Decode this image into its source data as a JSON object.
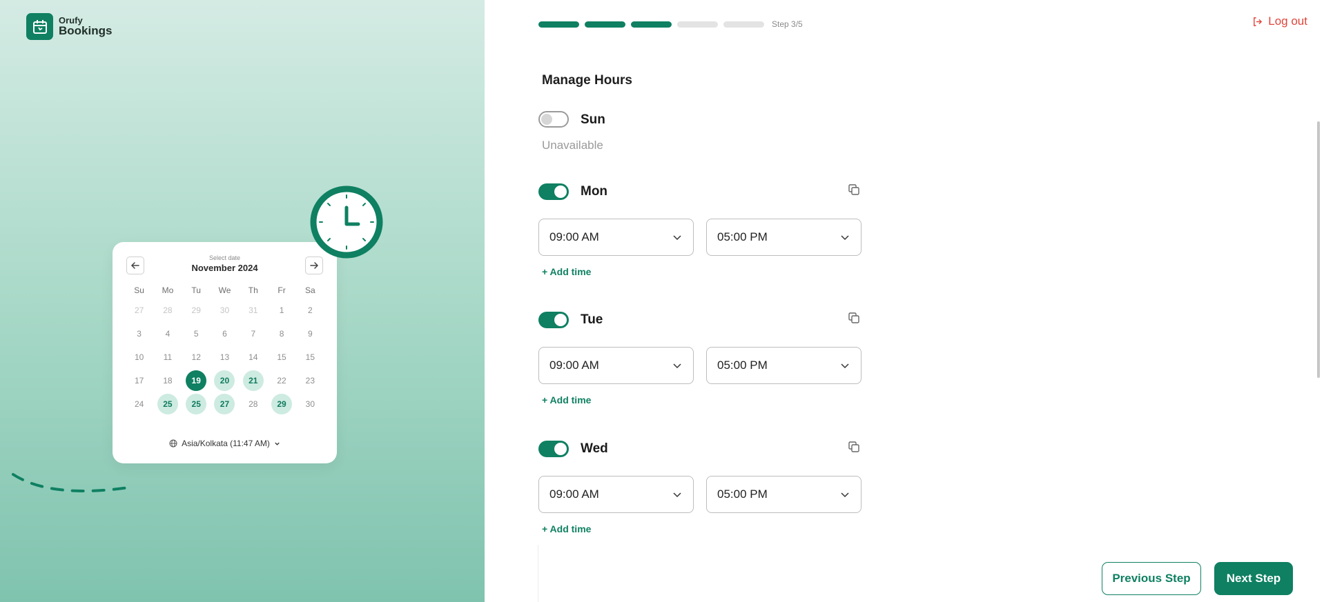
{
  "brand": {
    "name_small": "Orufy",
    "name_big": "Bookings",
    "color": "#0f8062",
    "icon": "calendar-clock-icon"
  },
  "calendar": {
    "select_label": "Select date",
    "month": "November 2024",
    "weekdays": [
      "Su",
      "Mo",
      "Tu",
      "We",
      "Th",
      "Fr",
      "Sa"
    ],
    "weeks": [
      [
        {
          "d": "27",
          "s": "other"
        },
        {
          "d": "28",
          "s": "other"
        },
        {
          "d": "29",
          "s": "other"
        },
        {
          "d": "30",
          "s": "other"
        },
        {
          "d": "31",
          "s": "other"
        },
        {
          "d": "1",
          "s": ""
        },
        {
          "d": "2",
          "s": ""
        }
      ],
      [
        {
          "d": "3",
          "s": ""
        },
        {
          "d": "4",
          "s": ""
        },
        {
          "d": "5",
          "s": ""
        },
        {
          "d": "6",
          "s": ""
        },
        {
          "d": "7",
          "s": ""
        },
        {
          "d": "8",
          "s": ""
        },
        {
          "d": "9",
          "s": ""
        }
      ],
      [
        {
          "d": "10",
          "s": ""
        },
        {
          "d": "11",
          "s": ""
        },
        {
          "d": "12",
          "s": ""
        },
        {
          "d": "13",
          "s": ""
        },
        {
          "d": "14",
          "s": ""
        },
        {
          "d": "15",
          "s": ""
        },
        {
          "d": "15",
          "s": ""
        }
      ],
      [
        {
          "d": "17",
          "s": ""
        },
        {
          "d": "18",
          "s": ""
        },
        {
          "d": "19",
          "s": "sel"
        },
        {
          "d": "20",
          "s": "avail"
        },
        {
          "d": "21",
          "s": "avail"
        },
        {
          "d": "22",
          "s": ""
        },
        {
          "d": "23",
          "s": ""
        }
      ],
      [
        {
          "d": "24",
          "s": ""
        },
        {
          "d": "25",
          "s": "avail"
        },
        {
          "d": "25",
          "s": "avail"
        },
        {
          "d": "27",
          "s": "avail"
        },
        {
          "d": "28",
          "s": ""
        },
        {
          "d": "29",
          "s": "avail"
        },
        {
          "d": "30",
          "s": ""
        }
      ]
    ],
    "timezone": "Asia/Kolkata (11:47 AM)"
  },
  "progress": {
    "total_steps": 5,
    "completed": 3,
    "label": "Step 3/5"
  },
  "header": {
    "logout_label": "Log out"
  },
  "schedule": {
    "title": "Manage Hours",
    "sun": {
      "name": "Sun",
      "enabled": false,
      "unavailable_label": "Unavailable"
    },
    "mon": {
      "name": "Mon",
      "enabled": true,
      "start": "09:00 AM",
      "end": "05:00 PM",
      "add_label": "+ Add time"
    },
    "tue": {
      "name": "Tue",
      "enabled": true,
      "start": "09:00 AM",
      "end": "05:00 PM",
      "add_label": "+ Add time"
    },
    "wed": {
      "name": "Wed",
      "enabled": true,
      "start": "09:00 AM",
      "end": "05:00 PM",
      "add_label": "+ Add time"
    }
  },
  "footer": {
    "prev_label": "Previous Step",
    "next_label": "Next Step"
  }
}
